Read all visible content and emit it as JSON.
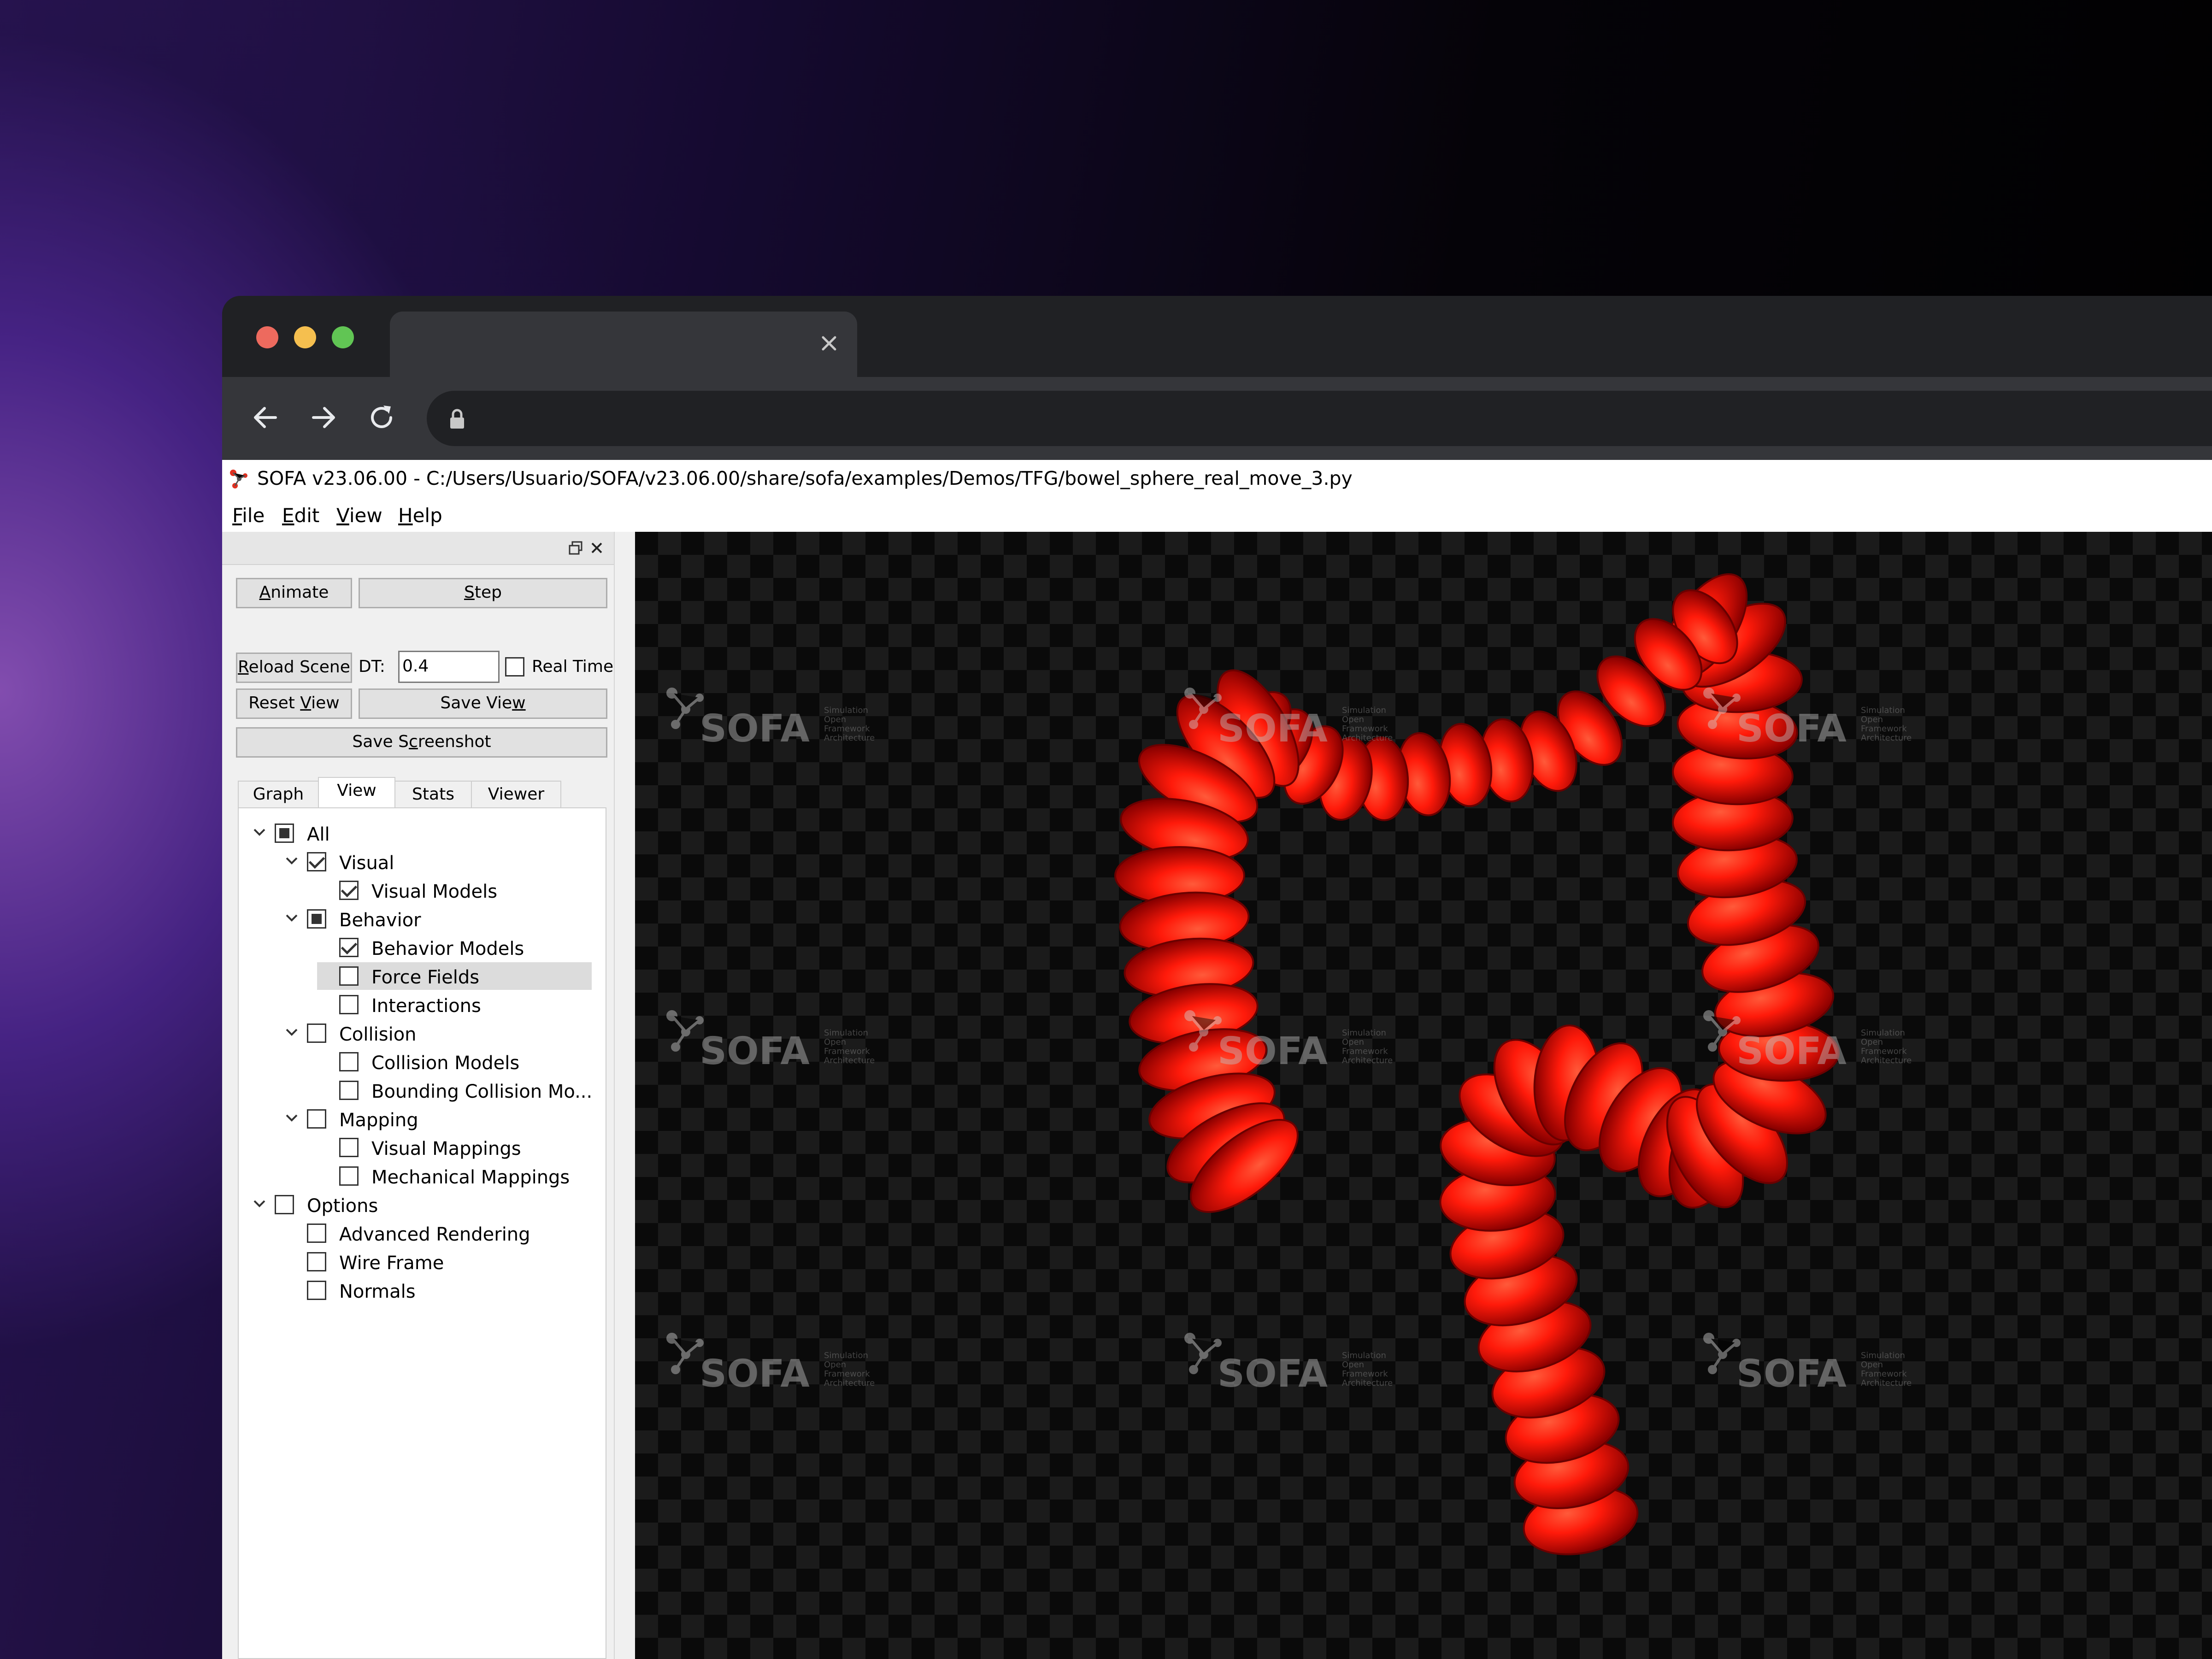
{
  "browser": {
    "tab": {
      "title": ""
    },
    "address": {
      "url": ""
    }
  },
  "app": {
    "title": "SOFA v23.06.00 - C:/Users/Usuario/SOFA/v23.06.00/share/sofa/examples/Demos/TFG/bowel_sphere_real_move_3.py",
    "menu": [
      {
        "label_first": "F",
        "label_rest": "ile"
      },
      {
        "label_first": "E",
        "label_rest": "dit"
      },
      {
        "label_first": "V",
        "label_rest": "iew"
      },
      {
        "label_first": "H",
        "label_rest": "elp"
      }
    ],
    "controls": {
      "animate_pre": "",
      "animate_u": "A",
      "animate_post": "nimate",
      "step_pre": "",
      "step_u": "S",
      "step_post": "tep",
      "reload_pre": "",
      "reload_u": "R",
      "reload_post": "eload Scene",
      "dt_label": "DT:",
      "dt_value": "0.4",
      "realtime_label": "Real Time",
      "realtime_checked": false,
      "reset_pre": "Reset ",
      "reset_u": "V",
      "reset_post": "iew",
      "saveview_pre": "Save Vie",
      "saveview_u": "w",
      "saveview_post": "",
      "screenshot_pre": "Save S",
      "screenshot_u": "c",
      "screenshot_post": "reenshot"
    },
    "panel_tabs": [
      {
        "label": "Graph",
        "active": false
      },
      {
        "label": "View",
        "active": true
      },
      {
        "label": "Stats",
        "active": false
      },
      {
        "label": "Viewer",
        "active": false
      }
    ],
    "tree": [
      {
        "label": "All",
        "level": 0,
        "state": "partial",
        "expandable": true
      },
      {
        "label": "Visual",
        "level": 1,
        "state": "checked",
        "expandable": true
      },
      {
        "label": "Visual Models",
        "level": 2,
        "state": "checked",
        "expandable": false
      },
      {
        "label": "Behavior",
        "level": 1,
        "state": "partial",
        "expandable": true
      },
      {
        "label": "Behavior Models",
        "level": 2,
        "state": "checked",
        "expandable": false
      },
      {
        "label": "Force Fields",
        "level": 2,
        "state": "unchecked",
        "expandable": false,
        "selected": true
      },
      {
        "label": "Interactions",
        "level": 2,
        "state": "unchecked",
        "expandable": false
      },
      {
        "label": "Collision",
        "level": 1,
        "state": "unchecked",
        "expandable": true
      },
      {
        "label": "Collision Models",
        "level": 2,
        "state": "unchecked",
        "expandable": false
      },
      {
        "label": "Bounding Collision Mo...",
        "level": 2,
        "state": "unchecked",
        "expandable": false
      },
      {
        "label": "Mapping",
        "level": 1,
        "state": "unchecked",
        "expandable": true
      },
      {
        "label": "Visual Mappings",
        "level": 2,
        "state": "unchecked",
        "expandable": false
      },
      {
        "label": "Mechanical Mappings",
        "level": 2,
        "state": "unchecked",
        "expandable": false
      },
      {
        "label": "Options",
        "level": 0,
        "state": "unchecked",
        "expandable": true
      },
      {
        "label": "Advanced Rendering",
        "level": 1,
        "state": "unchecked",
        "expandable": false
      },
      {
        "label": "Wire Frame",
        "level": 1,
        "state": "unchecked",
        "expandable": false
      },
      {
        "label": "Normals",
        "level": 1,
        "state": "unchecked",
        "expandable": false
      }
    ],
    "viewport": {
      "watermark_text": "SOFA",
      "watermark_sub": [
        "Simulation",
        "Open",
        "Framework",
        "Architecture"
      ],
      "model_color": "#ff1a0a"
    }
  },
  "colors": {
    "traffic_red": "#ed6a5e",
    "traffic_yellow": "#f5bf4f",
    "traffic_green": "#61c554",
    "chrome_dark": "#202124",
    "chrome_mid": "#35363a"
  }
}
